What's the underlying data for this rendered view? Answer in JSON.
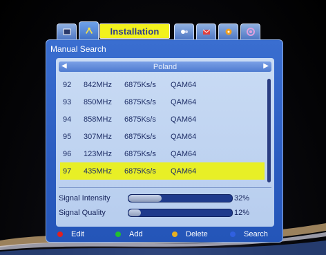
{
  "tabs": {
    "title": "Installation",
    "icons": [
      "tv-icon",
      "installation-icon",
      "av-icon",
      "mail-icon",
      "settings-icon",
      "system-icon"
    ]
  },
  "panel": {
    "header": "Manual Search",
    "satellite": "Poland"
  },
  "channels": [
    {
      "num": "92",
      "freq": "842MHz",
      "symbol": "6875Ks/s",
      "mod": "QAM64"
    },
    {
      "num": "93",
      "freq": "850MHz",
      "symbol": "6875Ks/s",
      "mod": "QAM64"
    },
    {
      "num": "94",
      "freq": "858MHz",
      "symbol": "6875Ks/s",
      "mod": "QAM64"
    },
    {
      "num": "95",
      "freq": "307MHz",
      "symbol": "6875Ks/s",
      "mod": "QAM64"
    },
    {
      "num": "96",
      "freq": "123MHz",
      "symbol": "6875Ks/s",
      "mod": "QAM64"
    },
    {
      "num": "97",
      "freq": "435MHz",
      "symbol": "6875Ks/s",
      "mod": "QAM64"
    }
  ],
  "selected_index": 5,
  "signal": {
    "intensity_label": "Signal Intensity",
    "intensity_value": "32%",
    "intensity_fraction": 0.32,
    "quality_label": "Signal Quality",
    "quality_value": "12%",
    "quality_fraction": 0.12
  },
  "footer": [
    {
      "label": "Edit",
      "color": "#e02020"
    },
    {
      "label": "Add",
      "color": "#20c030"
    },
    {
      "label": "Delete",
      "color": "#e8b020"
    },
    {
      "label": "Search",
      "color": "#3060e0"
    }
  ]
}
